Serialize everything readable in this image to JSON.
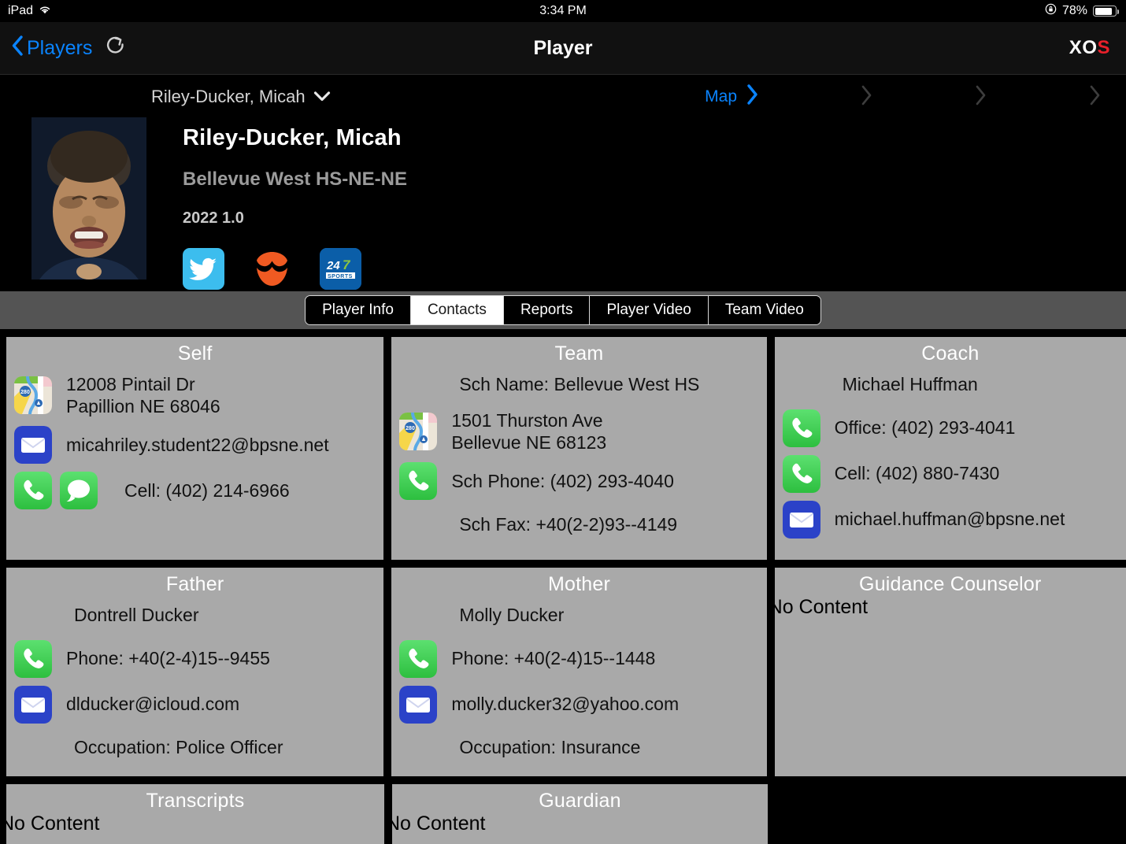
{
  "status_bar": {
    "device": "iPad",
    "wifi_icon": "wifi-icon",
    "time": "3:34 PM",
    "rotation_lock_icon": "rotation-lock-icon",
    "battery_percent": "78%",
    "battery_level": 78
  },
  "nav_bar": {
    "back_label": "Players",
    "back_icon": "chevron-left-icon",
    "refresh_icon": "refresh-icon",
    "title": "Player",
    "logo_x": "X",
    "logo_o": "O",
    "logo_s": "S",
    "accent_blue": "#0a84ff",
    "logo_red": "#e8202a"
  },
  "player_header": {
    "selector_label": "Riley-Ducker, Micah",
    "selector_caret_icon": "chevron-down-icon",
    "map_label": "Map",
    "map_chevron_icon": "chevron-right-icon",
    "extra_chevrons": [
      "chevron-right-icon",
      "chevron-right-icon",
      "chevron-right-icon"
    ],
    "name": "Riley-Ducker, Micah",
    "school": "Bellevue West HS-NE-NE",
    "class_year": "2022 1.0",
    "social": [
      {
        "name": "twitter-icon",
        "color": "#3cbdee"
      },
      {
        "name": "rivals-icon",
        "color": "#f05a22"
      },
      {
        "name": "247sports-icon",
        "color": "#0b5ea8"
      }
    ]
  },
  "tabs": {
    "items": [
      {
        "label": "Player Info",
        "active": false
      },
      {
        "label": "Contacts",
        "active": true
      },
      {
        "label": "Reports",
        "active": false
      },
      {
        "label": "Player Video",
        "active": false
      },
      {
        "label": "Team Video",
        "active": false
      }
    ]
  },
  "cards": {
    "self": {
      "title": "Self",
      "address": "12008 Pintail Dr\nPapillion NE 68046",
      "email": "micahriley.student22@bpsne.net",
      "cell": "Cell: (402) 214-6966"
    },
    "team": {
      "title": "Team",
      "school_name": "Sch Name: Bellevue West HS",
      "address": "1501 Thurston Ave\nBellevue NE 68123",
      "phone": "Sch Phone: (402) 293-4040",
      "fax": "Sch Fax: +40(2-2)93--4149"
    },
    "coach": {
      "title": "Coach",
      "name": "Michael Huffman",
      "office": "Office: (402) 293-4041",
      "cell": "Cell: (402) 880-7430",
      "email": "michael.huffman@bpsne.net"
    },
    "father": {
      "title": "Father",
      "name": "Dontrell Ducker",
      "phone": "Phone: +40(2-4)15--9455",
      "email": "dlducker@icloud.com",
      "occupation": "Occupation: Police Officer"
    },
    "mother": {
      "title": "Mother",
      "name": "Molly Ducker",
      "phone": "Phone: +40(2-4)15--1448",
      "email": "molly.ducker32@yahoo.com",
      "occupation": "Occupation: Insurance"
    },
    "guidance_counselor": {
      "title": "Guidance Counselor",
      "empty_text": "No Content"
    },
    "transcripts": {
      "title": "Transcripts",
      "empty_text": "No Content"
    },
    "guardian": {
      "title": "Guardian",
      "empty_text": "No Content"
    }
  },
  "icon_names": {
    "maps": "maps-icon",
    "mail": "mail-icon",
    "phone": "phone-icon",
    "messages": "messages-icon"
  },
  "colors": {
    "card_bg": "#a9a9a9",
    "tab_strip_bg": "#545454",
    "phone_green": "#4cd964",
    "mail_blue": "#2b42c8",
    "page_bg": "#000000"
  }
}
